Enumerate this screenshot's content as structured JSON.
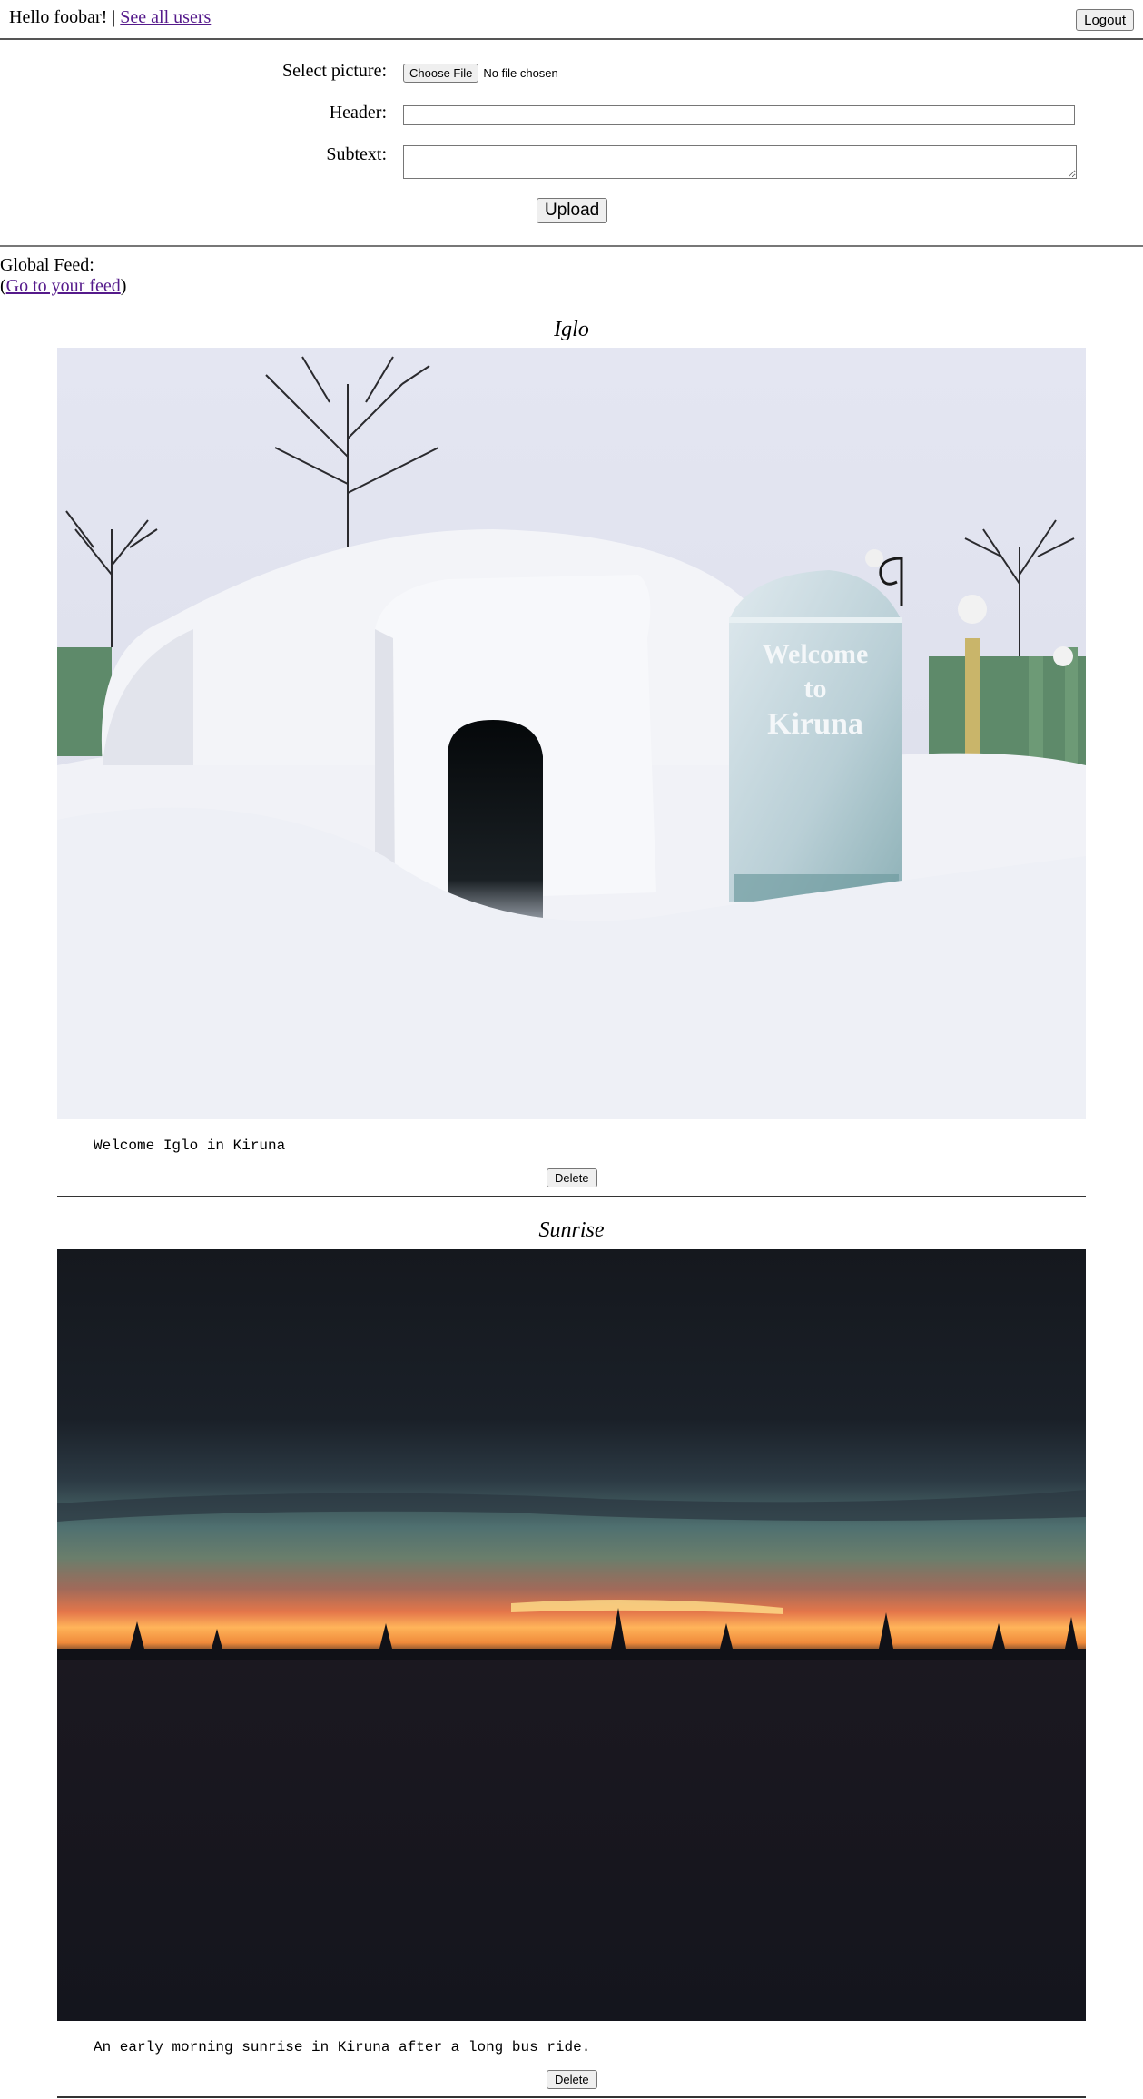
{
  "header": {
    "greeting": "Hello foobar! |",
    "see_all_users": "See all users",
    "logout": "Logout"
  },
  "upload_form": {
    "select_picture_label": "Select picture:",
    "choose_file": "Choose File",
    "no_file": "No file chosen",
    "header_label": "Header:",
    "header_value": "",
    "subtext_label": "Subtext:",
    "subtext_value": "",
    "upload": "Upload"
  },
  "feed": {
    "title": "Global Feed:",
    "link_prefix": "(",
    "link_text": "Go to your feed",
    "link_suffix": ")"
  },
  "posts": [
    {
      "title": "Iglo",
      "text": "Welcome Iglo in Kiruna",
      "image_sign": "Welcome to Kiruna",
      "delete": "Delete"
    },
    {
      "title": "Sunrise",
      "text": "An early morning sunrise in Kiruna after a long bus ride.",
      "delete": "Delete"
    }
  ]
}
